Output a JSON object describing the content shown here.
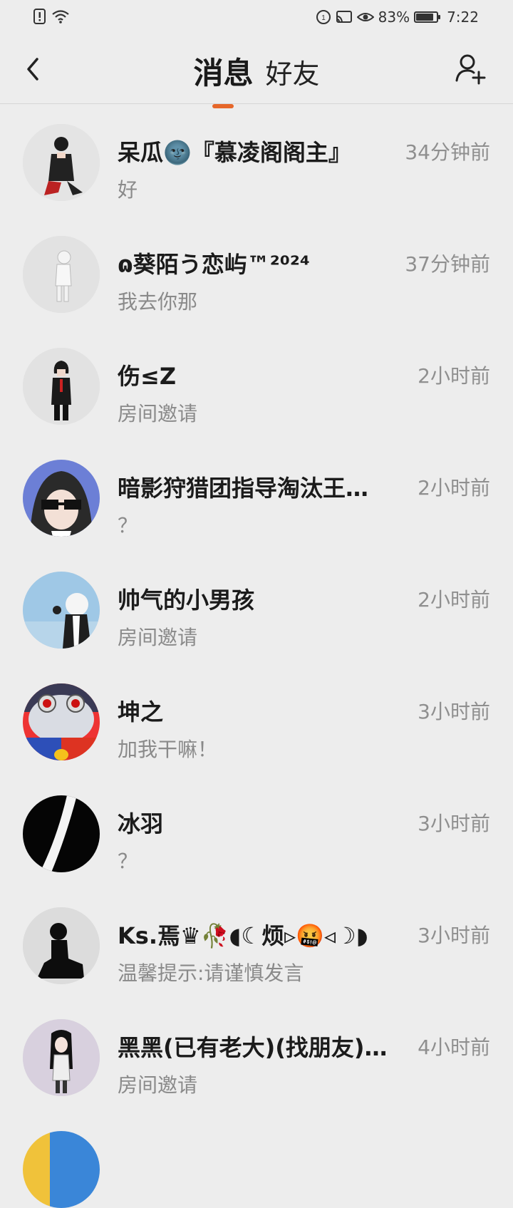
{
  "status_bar": {
    "battery": "83%",
    "time": "7:22"
  },
  "header": {
    "tabs": [
      {
        "label": "消息",
        "active": true
      },
      {
        "label": "好友",
        "active": false
      }
    ],
    "accent_color": "#e6672a"
  },
  "conversations": [
    {
      "name": "呆瓜🌚『慕凌阁阁主』",
      "preview": "好",
      "time": "34分钟前"
    },
    {
      "name": "ɷ葵陌う恋屿™²⁰²⁴",
      "preview": "我去你那",
      "time": "37分钟前"
    },
    {
      "name": "伤≤Z",
      "preview": "房间邀请",
      "time": "2小时前"
    },
    {
      "name": "暗影狩猎团指导淘汰王…",
      "preview": "？",
      "time": "2小时前"
    },
    {
      "name": "帅气的小男孩",
      "preview": "房间邀请",
      "time": "2小时前"
    },
    {
      "name": "坤之",
      "preview": "加我干嘛！",
      "time": "3小时前"
    },
    {
      "name": "冰羽",
      "preview": "？",
      "time": "3小时前"
    },
    {
      "name": "Ks.焉♛🥀◖☾烦▹🤬◃☽◗",
      "preview": "温馨提示:请谨慎发言",
      "time": "3小时前"
    },
    {
      "name": "黑黑(已有老大)(找朋友)…",
      "preview": "房间邀请",
      "time": "4小时前"
    }
  ]
}
